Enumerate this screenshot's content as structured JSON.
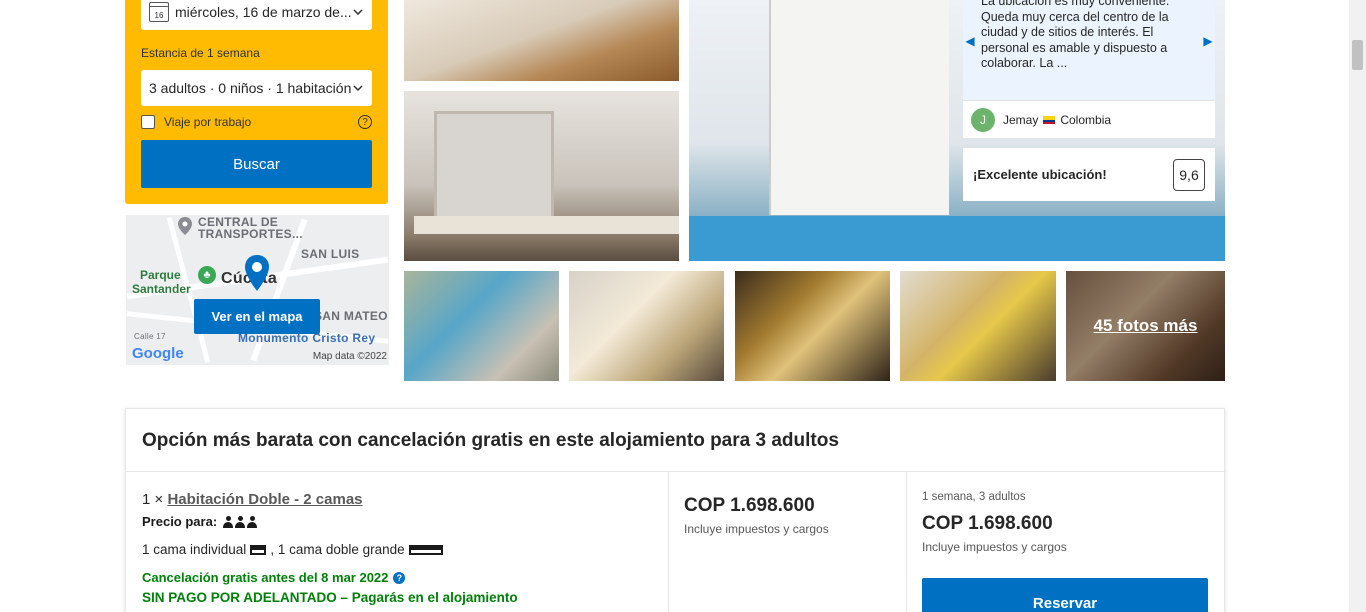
{
  "search": {
    "date_value": "miércoles, 16 de marzo de...",
    "calendar_day": "16",
    "stay_length": "Estancia de 1 semana",
    "guests_value": "3 adultos · 0 niños · 1 habitación",
    "work_trip_label": "Viaje por trabajo",
    "search_button": "Buscar"
  },
  "map": {
    "labels": [
      "CENTRAL DE",
      "TRANSPORTES...",
      "SAN LUIS",
      "Parque",
      "Santander",
      "Cúcuta",
      "SAN MATEO",
      "Monumento Cristo Rey",
      "Calle 17"
    ],
    "button": "Ver en el mapa",
    "google": "Google",
    "map_data": "Map data ©2022"
  },
  "photos": {
    "more_label": "45 fotos más"
  },
  "review": {
    "text": "La ubicación es muy conveniente. Queda muy cerca del centro de la ciudad y de sitios de interés. El personal es amable y dispuesto a colaborar. La ...",
    "reviewer_initial": "J",
    "reviewer_name": "Jemay",
    "reviewer_country": "Colombia",
    "highlight_label": "¡Excelente ubicación!",
    "score": "9,6"
  },
  "offer": {
    "title": "Opción más barata con cancelación gratis en este alojamiento para 3 adultos",
    "room_count": "1 ×",
    "room_name": "Habitación Doble - 2 camas",
    "price_for_label": "Precio para:",
    "bed_single": "1 cama individual",
    "bed_double": ", 1 cama doble grande",
    "cancellation": "Cancelación gratis antes del 8 mar 2022",
    "no_prepayment": "SIN PAGO POR ADELANTADO – Pagarás en el alojamiento",
    "price": "COP 1.698.600",
    "taxes": "Incluye impuestos y cargos",
    "stay_info": "1 semana, 3 adultos",
    "price_total": "COP 1.698.600",
    "taxes_total": "Incluye impuestos y cargos",
    "reserve_button": "Reservar"
  },
  "colors": {
    "accent": "#0071c2",
    "search_panel": "#febb02",
    "success": "#008009"
  }
}
